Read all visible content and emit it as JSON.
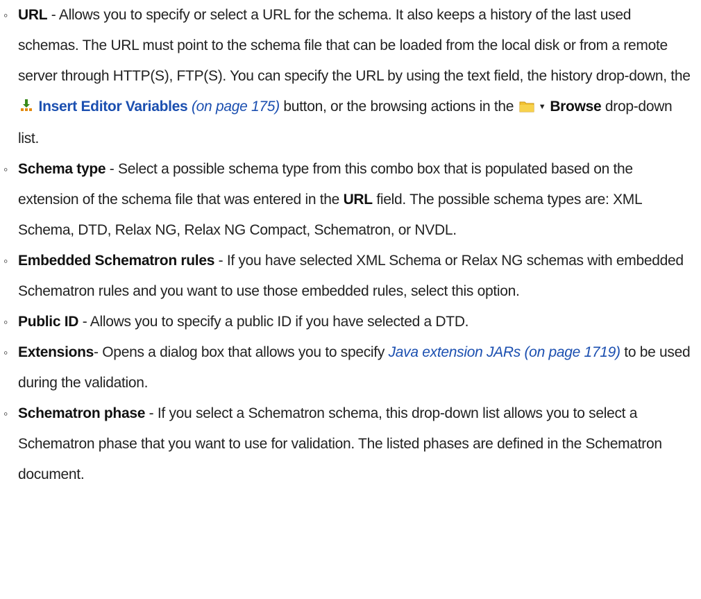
{
  "items": [
    {
      "term": "URL",
      "text1": " - Allows you to specify or select a URL for the schema. It also keeps a history of the last used schemas. The URL must point to the schema file that can be loaded from the local disk or from a remote server through HTTP(S), FTP(S). You can specify the URL by using the text field, the history drop-down, the ",
      "insert_link": "Insert Editor Variables",
      "insert_ref": "(on page 175)",
      "text2": " button, or the browsing actions in the ",
      "browse_label": "Browse",
      "text3": " drop-down list."
    },
    {
      "term": "Schema type",
      "text1": " - Select a possible schema type from this combo box that is populated based on the extension of the schema file that was entered in the ",
      "url_term": "URL",
      "text2": " field. The possible schema types are: XML Schema, DTD, Relax NG, Relax NG Compact, Schematron, or NVDL."
    },
    {
      "term": "Embedded Schematron rules",
      "text": " - If you have selected XML Schema or Relax NG schemas with embedded Schematron rules and you want to use those embedded rules, select this option."
    },
    {
      "term": "Public ID",
      "text": " - Allows you to specify a public ID if you have selected a DTD."
    },
    {
      "term": "Extensions",
      "text1": "- Opens a dialog box that allows you to specify ",
      "link": "Java extension JARs (on page 1719)",
      "text2": " to be used during the validation."
    },
    {
      "term": "Schematron phase",
      "text": " - If you select a Schematron schema, this drop-down list allows you to select a Schematron phase that you want to use for validation. The listed phases are defined in the Schematron document."
    }
  ],
  "bullet_char": "◦",
  "icons": [
    "insert-editor-variables-icon",
    "folder-icon",
    "dropdown-arrow-icon"
  ],
  "colors": {
    "link": "#1b4fb0",
    "text": "#222222",
    "icon_green": "#3a8a1c",
    "icon_orange": "#e38a10",
    "folder": "#f2c232"
  }
}
